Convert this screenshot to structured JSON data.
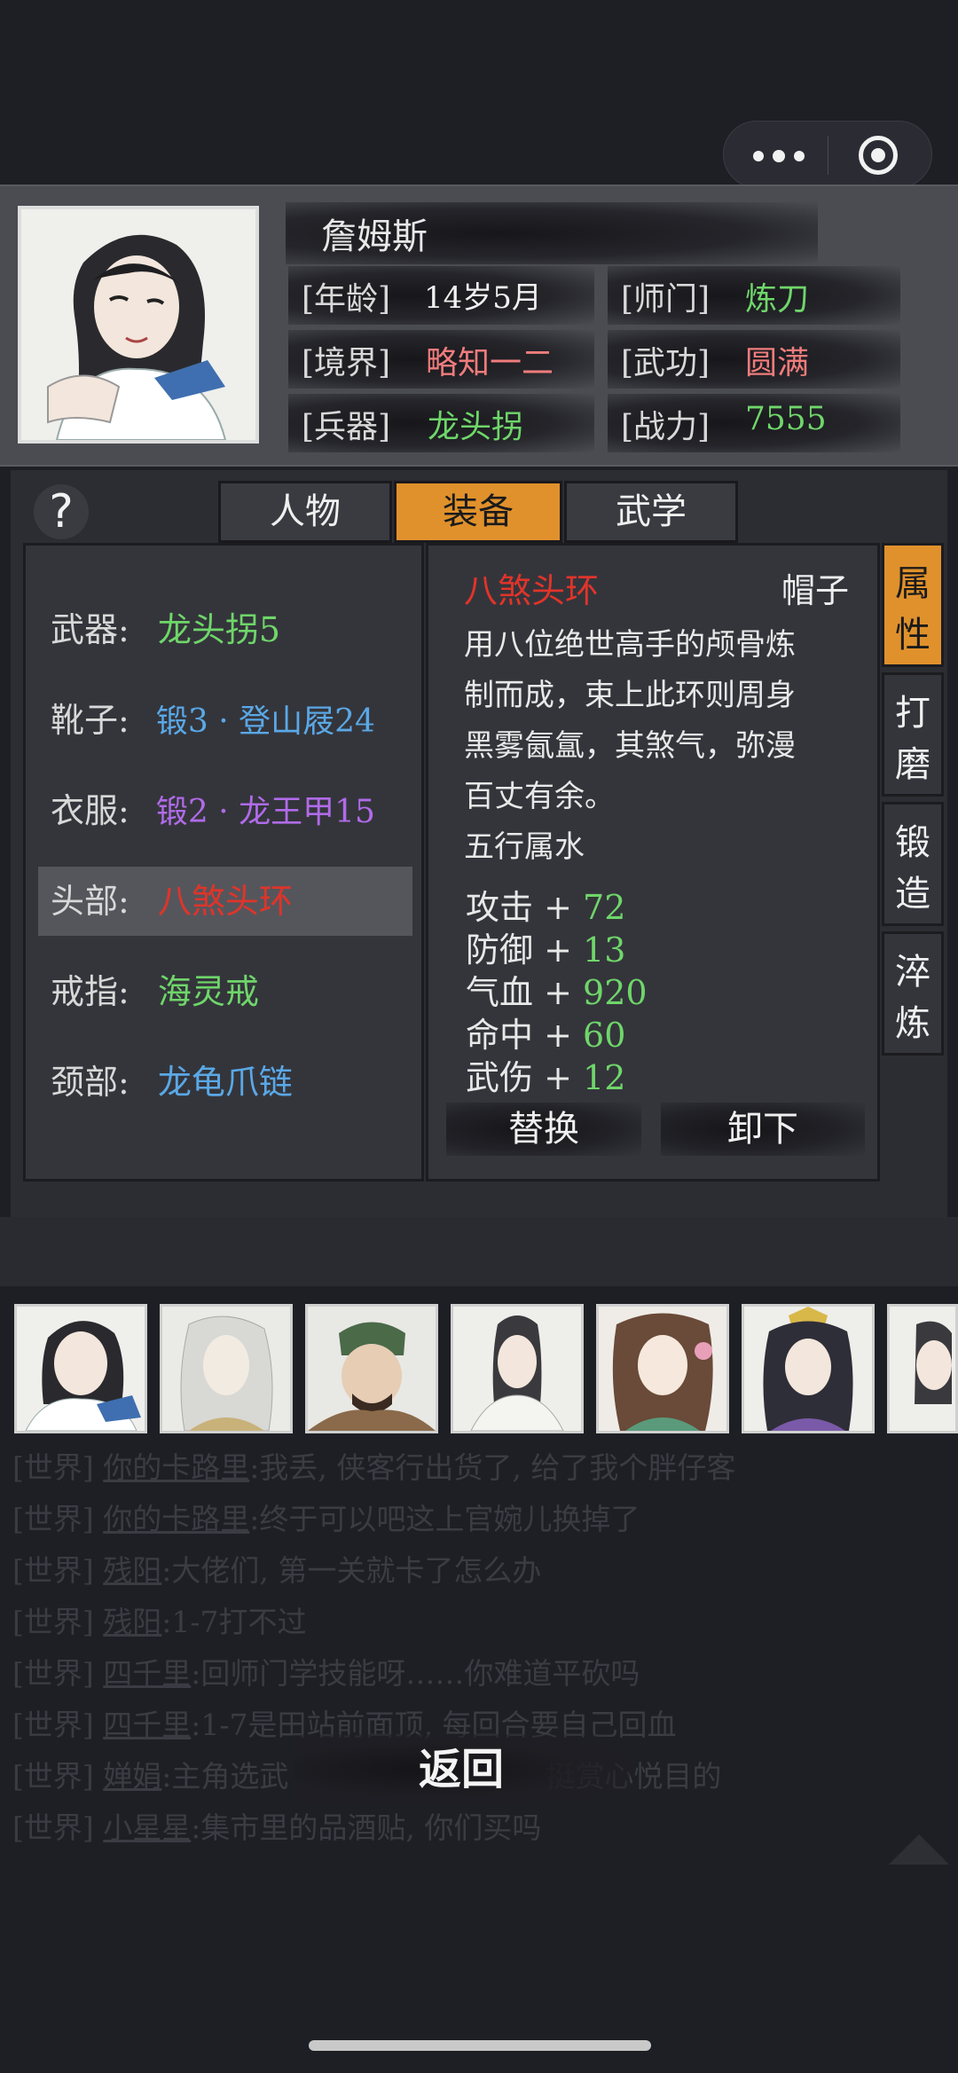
{
  "header": {
    "name": "詹姆斯",
    "rows": [
      {
        "l_label": "[年龄]",
        "l_value": "14岁5月",
        "r_label": "[师门]",
        "r_value": "炼刀"
      },
      {
        "l_label": "[境界]",
        "l_value": "略知一二",
        "r_label": "[武功]",
        "r_value": "圆满"
      },
      {
        "l_label": "[兵器]",
        "l_value": "龙头拐",
        "r_label": "[战力]",
        "r_value": "7555"
      }
    ]
  },
  "help": "?",
  "tabs": [
    "人物",
    "装备",
    "武学"
  ],
  "slots": [
    {
      "label": "武器:",
      "value": "龙头拐5"
    },
    {
      "label": "靴子:",
      "value": "锻3 · 登山屐24"
    },
    {
      "label": "衣服:",
      "value": "锻2 · 龙王甲15"
    },
    {
      "label": "头部:",
      "value": "八煞头环"
    },
    {
      "label": "戒指:",
      "value": "海灵戒"
    },
    {
      "label": "颈部:",
      "value": "龙龟爪链"
    }
  ],
  "detail": {
    "name": "八煞头环",
    "type": "帽子",
    "desc_lines": [
      "用八位绝世高手的颅骨炼",
      "制而成，束上此环则周身",
      "黑雾氤氲，其煞气，弥漫",
      "百丈有余。"
    ],
    "element": "五行属水",
    "bonuses": [
      {
        "label": "攻击",
        "sign": "+",
        "value": "72"
      },
      {
        "label": "防御",
        "sign": "+",
        "value": "13"
      },
      {
        "label": "气血",
        "sign": "+",
        "value": "920"
      },
      {
        "label": "命中",
        "sign": "+",
        "value": "60"
      },
      {
        "label": "武伤",
        "sign": "+",
        "value": "12"
      }
    ],
    "replace": "替换",
    "unequip": "卸下"
  },
  "side_tabs": [
    [
      "属",
      "性"
    ],
    [
      "打",
      "磨"
    ],
    [
      "锻",
      "造"
    ],
    [
      "淬",
      "炼"
    ]
  ],
  "chat": [
    {
      "channel": "[世界]",
      "user": "你的卡路里",
      "msg": ":我丢, 侠客行出货了, 给了我个胖仔客"
    },
    {
      "channel": "[世界]",
      "user": "你的卡路里",
      "msg": ":终于可以吧这上官婉儿换掉了"
    },
    {
      "channel": "[世界]",
      "user": "残阳",
      "msg": ":大佬们, 第一关就卡了怎么办"
    },
    {
      "channel": "[世界]",
      "user": "残阳",
      "msg": ":1-7打不过"
    },
    {
      "channel": "[世界]",
      "user": "四千里",
      "msg": ":回师门学技能呀……你难道平砍吗"
    },
    {
      "channel": "[世界]",
      "user": "四千里",
      "msg": ":1-7是田站前面顶, 每回合要自己回血"
    },
    {
      "channel": "[世界]",
      "user": "婵娟",
      "msg": ":主角选武",
      "tail": "挺赏心悦目的"
    },
    {
      "channel": "[世界]",
      "user": "小星星",
      "msg": ":集市里的品酒贴, 你们买吗"
    }
  ],
  "back": "返回",
  "colors": {
    "accent": "#e0912c",
    "green": "#6fd66a",
    "red": "#e0342a",
    "blue": "#5aa8e6",
    "purple": "#b06be8",
    "pink": "#f07c7c"
  }
}
